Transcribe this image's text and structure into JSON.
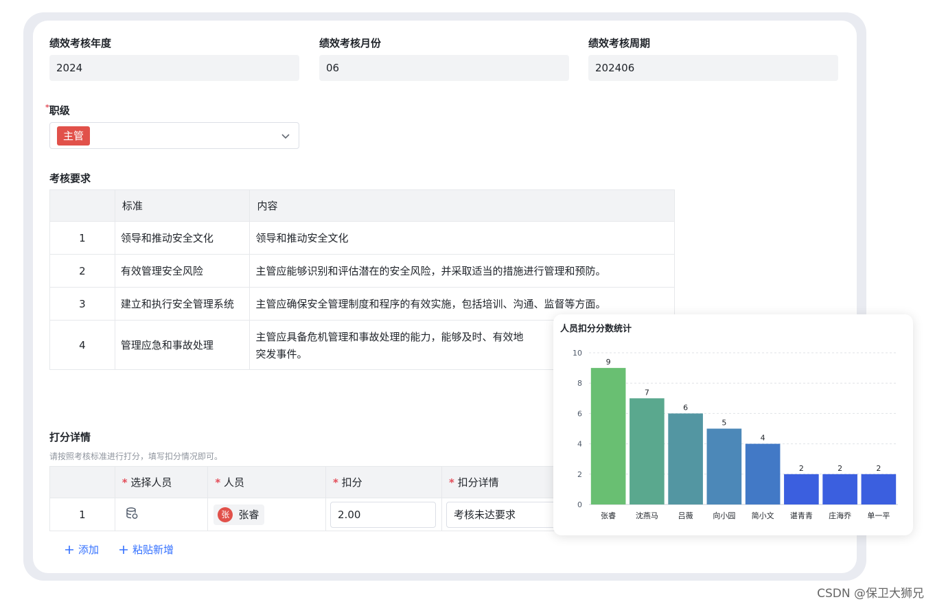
{
  "form": {
    "year_label": "绩效考核年度",
    "year_value": "2024",
    "month_label": "绩效考核月份",
    "month_value": "06",
    "period_label": "绩效考核周期",
    "period_value": "202406",
    "level_required": "*",
    "level_label": "职级",
    "level_value": "主管"
  },
  "requirements": {
    "title": "考核要求",
    "headers": [
      "",
      "标准",
      "内容"
    ],
    "rows": [
      {
        "no": "1",
        "standard": "领导和推动安全文化",
        "content": "领导和推动安全文化"
      },
      {
        "no": "2",
        "standard": "有效管理安全风险",
        "content": "主管应能够识别和评估潜在的安全风险，并采取适当的措施进行管理和预防。"
      },
      {
        "no": "3",
        "standard": "建立和执行安全管理系统",
        "content": "主管应确保安全管理制度和程序的有效实施，包括培训、沟通、监督等方面。"
      },
      {
        "no": "4",
        "standard": "管理应急和事故处理",
        "content": "主管应具备危机管理和事故处理的能力，能够及时、有效地",
        "content2": "突发事件。"
      }
    ]
  },
  "scoring": {
    "title": "打分详情",
    "help": "请按照考核标准进行打分，填写扣分情况即可。",
    "required_mark": "*",
    "headers": [
      "选择人员",
      "人员",
      "扣分",
      "扣分详情"
    ],
    "rows": [
      {
        "no": "1",
        "person_avatar": "张",
        "person": "张睿",
        "score": "2.00",
        "detail": "考核未达要求"
      }
    ],
    "add_label": "添加",
    "paste_label": "粘贴新增"
  },
  "chart_data": {
    "type": "bar",
    "title": "人员扣分分数统计",
    "categories": [
      "张睿",
      "沈燕马",
      "吕薇",
      "向小园",
      "简小文",
      "谌青青",
      "庄海乔",
      "单一平"
    ],
    "values": [
      9,
      7,
      6,
      5,
      4,
      2,
      2,
      2
    ],
    "ylim": [
      0,
      10
    ],
    "yticks": [
      0,
      2,
      4,
      6,
      8,
      10
    ],
    "xlabel": "",
    "ylabel": "",
    "grid": true,
    "colors": [
      "#69bf72",
      "#5aa88e",
      "#5396a2",
      "#4c88b8",
      "#4279c6",
      "#3b5fdf",
      "#3b5fdf",
      "#3b5fdf"
    ]
  },
  "watermark": "CSDN @保卫大狮兄"
}
